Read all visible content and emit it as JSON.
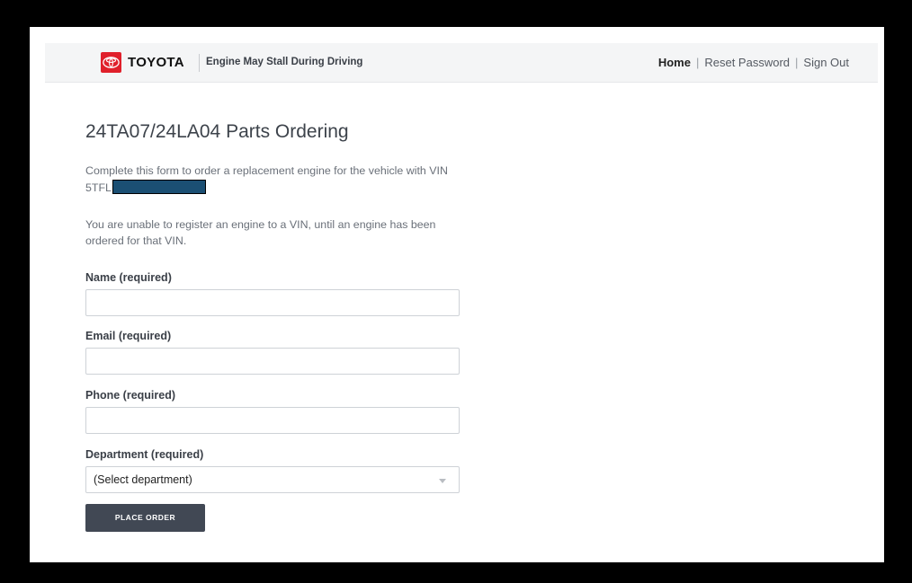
{
  "header": {
    "brand": "TOYOTA",
    "campaign_title": "Engine May Stall During Driving",
    "nav": {
      "home": "Home",
      "reset_password": "Reset Password",
      "sign_out": "Sign Out",
      "separator": "|"
    }
  },
  "main": {
    "title": "24TA07/24LA04 Parts Ordering",
    "intro_text": "Complete this form to order a replacement engine for the vehicle with VIN",
    "vin_prefix": "5TFL",
    "notice_text": "You are unable to register an engine to a VIN, until an engine has been ordered for that VIN.",
    "form": {
      "name_label": "Name (required)",
      "name_value": "",
      "email_label": "Email (required)",
      "email_value": "",
      "phone_label": "Phone (required)",
      "phone_value": "",
      "department_label": "Department (required)",
      "department_selected": "(Select department)",
      "submit_label": "PLACE ORDER"
    }
  },
  "colors": {
    "brand_red": "#e0202b",
    "button_bg": "#414854",
    "vin_redaction": "#1b4f73"
  },
  "icons": [
    "toyota-logo-icon",
    "chevron-down-icon"
  ]
}
